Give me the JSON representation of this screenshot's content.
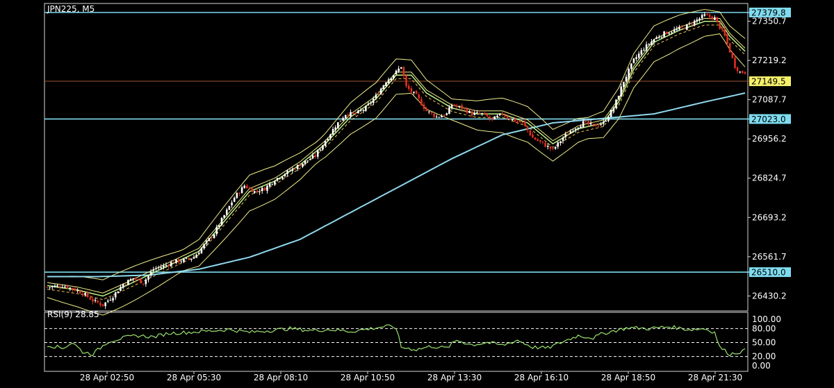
{
  "symbol_label": "JPN225, M5",
  "rsi_label": "RSI(9) 28.85",
  "colors": {
    "background": "#000000",
    "frame": "#d8d8d8",
    "up_candle": "#ffffff",
    "down_candle": "#e03020",
    "level_line": "#7fdcef",
    "level_label_bg": "#7fdcef",
    "current_price_label_bg": "#f5f06a",
    "current_price_line": "#a0522d",
    "ma_slow": "#8fd9ee",
    "ma_fast": "#bff58a",
    "band_line": "#f2ef8a",
    "band_mid": "#f2c35a",
    "rsi_line": "#9be36f",
    "rsi_guide": "#ffffff"
  },
  "chart_data": [
    {
      "type": "candlestick",
      "title": "JPN225, M5",
      "ylim": [
        26380,
        27410
      ],
      "y_tick_labels": [
        "27350.7",
        "27219.2",
        "27087.7",
        "26956.2",
        "26824.7",
        "26693.2",
        "26561.7",
        "26430.2"
      ],
      "x_tick_labels": [
        "28 Apr 02:50",
        "28 Apr 05:30",
        "28 Apr 08:10",
        "28 Apr 10:50",
        "28 Apr 13:30",
        "28 Apr 16:10",
        "28 Apr 18:50",
        "28 Apr 21:30"
      ],
      "horizontal_levels": [
        27379.8,
        27023.0,
        26510.0
      ],
      "current_price": 27149.5,
      "close_path": [
        [
          0,
          26460
        ],
        [
          6,
          26465
        ],
        [
          10,
          26455
        ],
        [
          14,
          26440
        ],
        [
          18,
          26415
        ],
        [
          22,
          26400
        ],
        [
          26,
          26430
        ],
        [
          30,
          26470
        ],
        [
          34,
          26490
        ],
        [
          38,
          26475
        ],
        [
          42,
          26520
        ],
        [
          46,
          26530
        ],
        [
          50,
          26545
        ],
        [
          54,
          26550
        ],
        [
          58,
          26560
        ],
        [
          62,
          26600
        ],
        [
          66,
          26640
        ],
        [
          70,
          26700
        ],
        [
          74,
          26760
        ],
        [
          78,
          26800
        ],
        [
          82,
          26780
        ],
        [
          86,
          26790
        ],
        [
          90,
          26820
        ],
        [
          94,
          26840
        ],
        [
          98,
          26860
        ],
        [
          102,
          26880
        ],
        [
          106,
          26900
        ],
        [
          110,
          26950
        ],
        [
          114,
          27000
        ],
        [
          118,
          27040
        ],
        [
          122,
          27040
        ],
        [
          126,
          27060
        ],
        [
          130,
          27100
        ],
        [
          134,
          27150
        ],
        [
          138,
          27180
        ],
        [
          140,
          27200
        ],
        [
          142,
          27130
        ],
        [
          146,
          27100
        ],
        [
          150,
          27050
        ],
        [
          154,
          27030
        ],
        [
          158,
          27040
        ],
        [
          160,
          27070
        ],
        [
          164,
          27060
        ],
        [
          168,
          27040
        ],
        [
          172,
          27040
        ],
        [
          176,
          27020
        ],
        [
          180,
          27040
        ],
        [
          184,
          27020
        ],
        [
          188,
          27010
        ],
        [
          192,
          26960
        ],
        [
          196,
          26940
        ],
        [
          200,
          26920
        ],
        [
          204,
          26960
        ],
        [
          208,
          26990
        ],
        [
          212,
          27010
        ],
        [
          216,
          27000
        ],
        [
          220,
          27010
        ],
        [
          224,
          27060
        ],
        [
          228,
          27150
        ],
        [
          232,
          27220
        ],
        [
          236,
          27260
        ],
        [
          240,
          27290
        ],
        [
          244,
          27310
        ],
        [
          248,
          27320
        ],
        [
          252,
          27330
        ],
        [
          256,
          27350
        ],
        [
          260,
          27370
        ],
        [
          264,
          27360
        ],
        [
          266,
          27330
        ],
        [
          268,
          27300
        ],
        [
          270,
          27250
        ],
        [
          272,
          27200
        ],
        [
          274,
          27180
        ],
        [
          276,
          27180
        ]
      ],
      "series": [
        {
          "name": "",
          "color_key": "ma_slow",
          "values": [
            [
              0,
              26495
            ],
            [
              20,
              26495
            ],
            [
              40,
              26500
            ],
            [
              60,
              26520
            ],
            [
              80,
              26560
            ],
            [
              100,
              26620
            ],
            [
              120,
              26710
            ],
            [
              140,
              26800
            ],
            [
              160,
              26890
            ],
            [
              180,
              26970
            ],
            [
              200,
              27010
            ],
            [
              220,
              27025
            ],
            [
              240,
              27040
            ],
            [
              260,
              27080
            ],
            [
              276,
              27110
            ]
          ]
        },
        {
          "name": "",
          "color_key": "ma_fast",
          "values": [
            [
              0,
              26465
            ],
            [
              12,
              26450
            ],
            [
              22,
              26430
            ],
            [
              30,
              26460
            ],
            [
              40,
              26500
            ],
            [
              50,
              26540
            ],
            [
              60,
              26580
            ],
            [
              70,
              26680
            ],
            [
              80,
              26780
            ],
            [
              90,
              26815
            ],
            [
              100,
              26870
            ],
            [
              110,
              26940
            ],
            [
              120,
              27030
            ],
            [
              130,
              27090
            ],
            [
              138,
              27170
            ],
            [
              144,
              27170
            ],
            [
              150,
              27110
            ],
            [
              160,
              27060
            ],
            [
              170,
              27040
            ],
            [
              180,
              27040
            ],
            [
              190,
              27010
            ],
            [
              200,
              26940
            ],
            [
              210,
              26990
            ],
            [
              220,
              27010
            ],
            [
              226,
              27080
            ],
            [
              232,
              27190
            ],
            [
              240,
              27280
            ],
            [
              250,
              27320
            ],
            [
              260,
              27350
            ],
            [
              266,
              27350
            ],
            [
              270,
              27300
            ],
            [
              276,
              27250
            ]
          ]
        }
      ]
    },
    {
      "type": "line",
      "title": "RSI(9) 28.85",
      "ylim": [
        0,
        100
      ],
      "y_tick_labels": [
        "100.00",
        "80.00",
        "50.00",
        "20.00",
        "0.00"
      ],
      "guide_levels": [
        80,
        50,
        20
      ],
      "last_value": 28.85,
      "values": [
        [
          0,
          45
        ],
        [
          6,
          38
        ],
        [
          10,
          50
        ],
        [
          14,
          30
        ],
        [
          18,
          25
        ],
        [
          24,
          52
        ],
        [
          30,
          60
        ],
        [
          36,
          65
        ],
        [
          42,
          62
        ],
        [
          48,
          70
        ],
        [
          56,
          72
        ],
        [
          64,
          75
        ],
        [
          72,
          78
        ],
        [
          80,
          72
        ],
        [
          88,
          76
        ],
        [
          96,
          80
        ],
        [
          104,
          76
        ],
        [
          112,
          78
        ],
        [
          120,
          74
        ],
        [
          128,
          80
        ],
        [
          134,
          85
        ],
        [
          138,
          82
        ],
        [
          140,
          40
        ],
        [
          146,
          35
        ],
        [
          152,
          42
        ],
        [
          158,
          38
        ],
        [
          162,
          55
        ],
        [
          168,
          45
        ],
        [
          174,
          50
        ],
        [
          180,
          44
        ],
        [
          186,
          55
        ],
        [
          192,
          40
        ],
        [
          198,
          38
        ],
        [
          204,
          52
        ],
        [
          210,
          65
        ],
        [
          216,
          60
        ],
        [
          220,
          70
        ],
        [
          224,
          75
        ],
        [
          230,
          82
        ],
        [
          238,
          80
        ],
        [
          246,
          84
        ],
        [
          254,
          78
        ],
        [
          260,
          80
        ],
        [
          264,
          72
        ],
        [
          266,
          40
        ],
        [
          270,
          25
        ],
        [
          274,
          30
        ],
        [
          276,
          33
        ]
      ]
    }
  ]
}
